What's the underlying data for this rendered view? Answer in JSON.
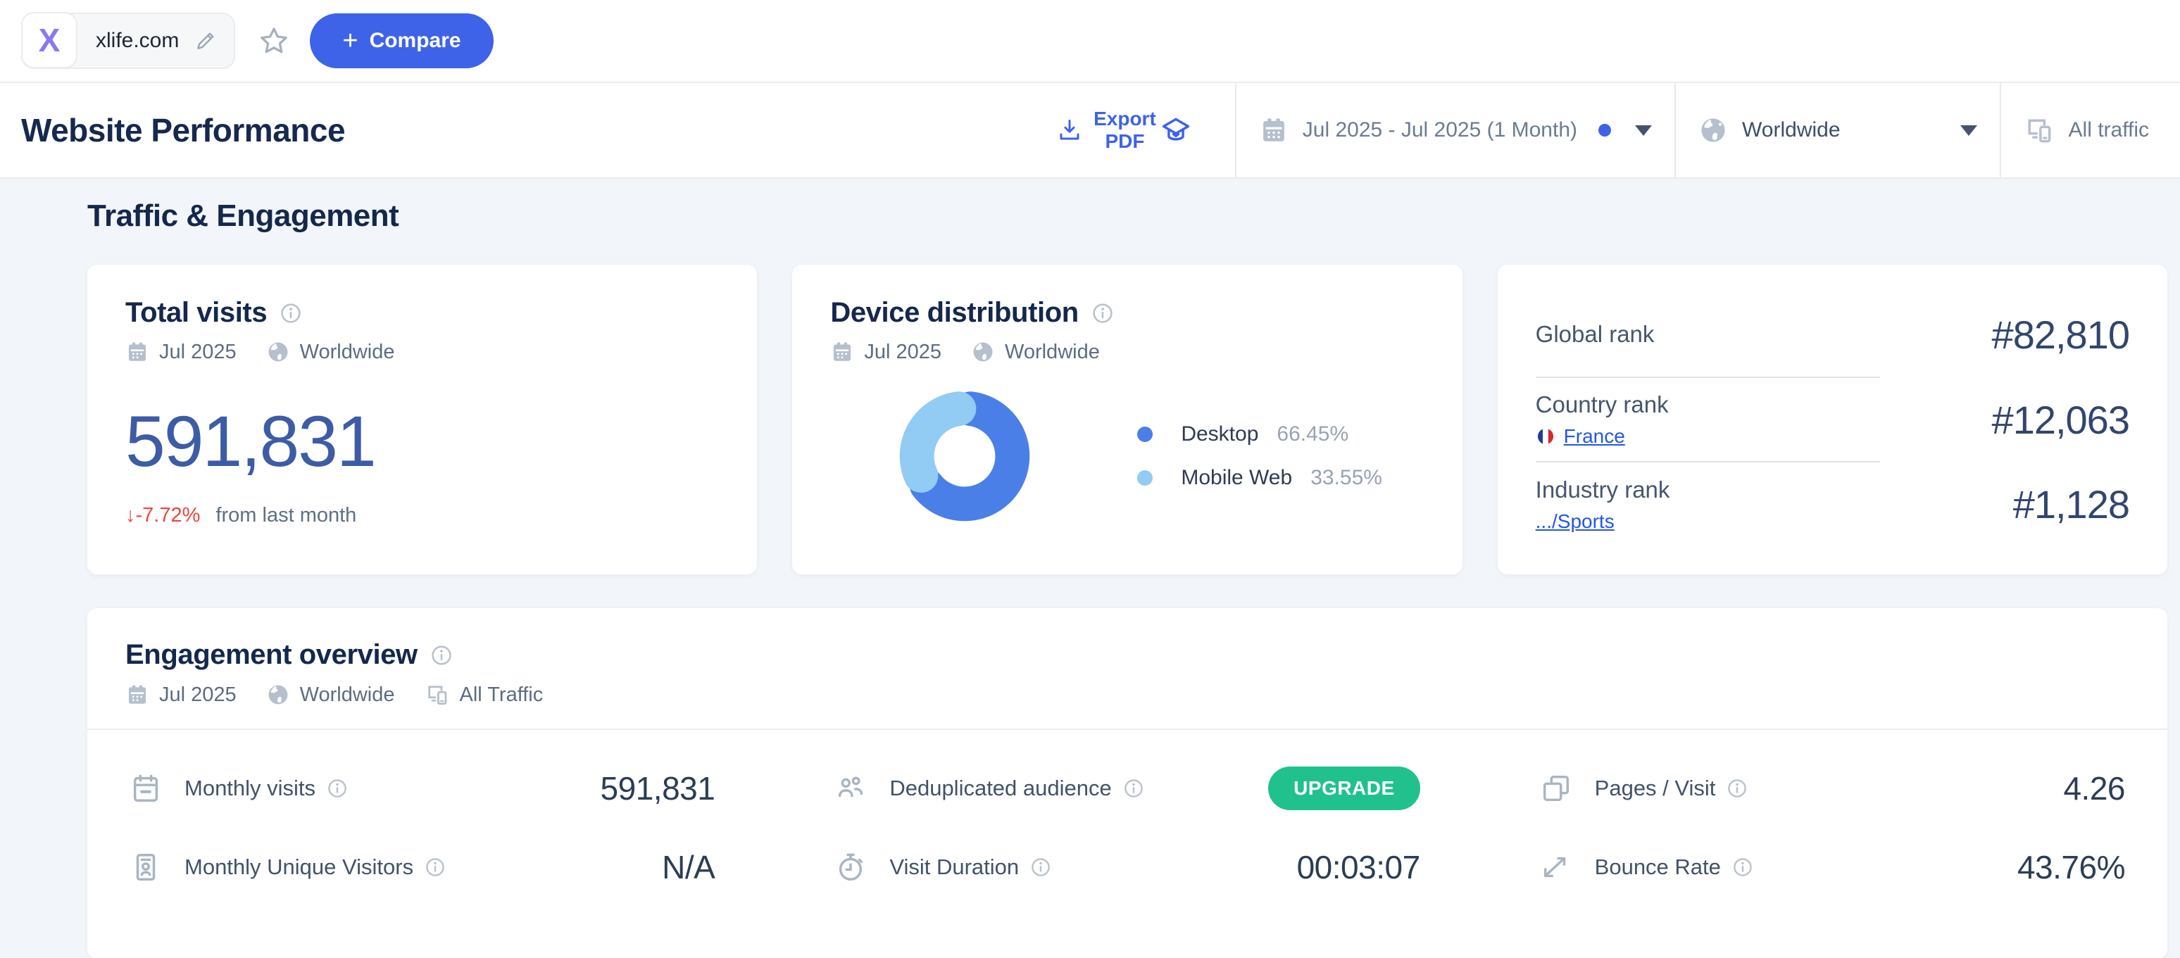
{
  "topbar": {
    "logo_letter": "X",
    "domain": "xlife.com",
    "compare_plus": "+",
    "compare_label": "Compare"
  },
  "header": {
    "title": "Website Performance",
    "export_label": "Export\nPDF",
    "date_range": "Jul 2025 - Jul 2025 (1 Month)",
    "country_filter": "Worldwide",
    "traffic_filter": "All traffic"
  },
  "section": {
    "title": "Traffic & Engagement"
  },
  "total_visits": {
    "title": "Total visits",
    "period": "Jul 2025",
    "geo": "Worldwide",
    "value": "591,831",
    "change": "↓-7.72%",
    "change_suffix": "from last month"
  },
  "device_distribution": {
    "title": "Device distribution",
    "period": "Jul 2025",
    "geo": "Worldwide",
    "legend": [
      {
        "label": "Desktop",
        "value": "66.45%"
      },
      {
        "label": "Mobile Web",
        "value": "33.55%"
      }
    ]
  },
  "chart_data": {
    "type": "pie",
    "title": "Device distribution",
    "categories": [
      "Desktop",
      "Mobile Web"
    ],
    "values": [
      66.45,
      33.55
    ],
    "colors": [
      "#4b7fe8",
      "#92cbf4"
    ],
    "donut": true,
    "legend_position": "right"
  },
  "ranks": {
    "rows": [
      {
        "label": "Global rank",
        "value": "#82,810"
      },
      {
        "label": "Country rank",
        "link": "France",
        "value": "#12,063"
      },
      {
        "label": "Industry rank",
        "link": ".../Sports",
        "value": "#1,128"
      }
    ]
  },
  "engagement": {
    "title": "Engagement overview",
    "period": "Jul 2025",
    "geo": "Worldwide",
    "traffic": "All Traffic",
    "metrics": [
      {
        "label": "Monthly visits",
        "value": "591,831"
      },
      {
        "label": "Deduplicated audience",
        "value": "UPGRADE"
      },
      {
        "label": "Pages / Visit",
        "value": "4.26"
      },
      {
        "label": "Monthly Unique Visitors",
        "value": "N/A"
      },
      {
        "label": "Visit Duration",
        "value": "00:03:07"
      },
      {
        "label": "Bounce Rate",
        "value": "43.76%"
      }
    ]
  },
  "colors": {
    "accent_blue": "#3e63e8",
    "upgrade_green": "#21c18d",
    "negative_red": "#e8483b",
    "link_blue": "#2156e8",
    "big_number_blue": "#3d5ca5"
  }
}
